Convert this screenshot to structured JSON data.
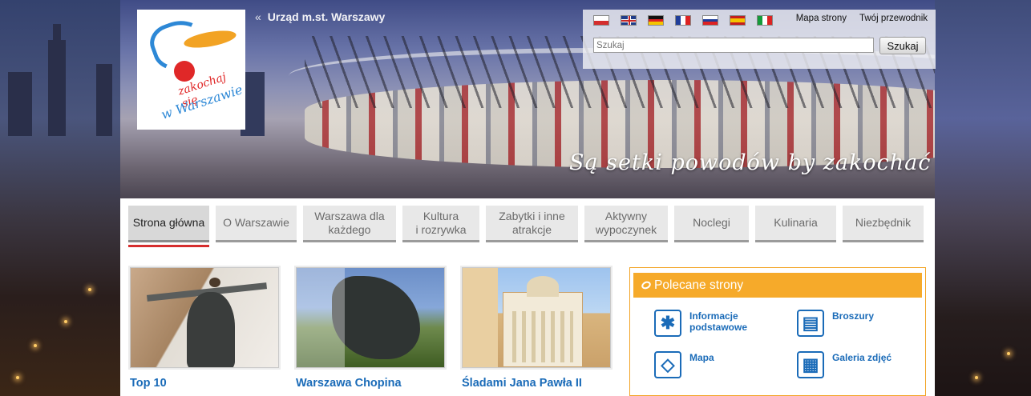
{
  "header": {
    "city_link": "Urząd m.st. Warszawy",
    "city_link_chevron": "«",
    "logo_line1": "zakochaj się",
    "logo_line2": "w Warszawie",
    "slogan": "Są setki powodów by zakochać się w Warszawie"
  },
  "utility": {
    "languages": [
      "polish-flag",
      "uk-flag",
      "german-flag",
      "french-flag",
      "russian-flag",
      "spanish-flag",
      "italian-flag"
    ],
    "links": [
      "Mapa strony",
      "Twój przewodnik"
    ],
    "search_placeholder": "Szukaj",
    "search_button": "Szukaj"
  },
  "nav": [
    {
      "label": "Strona główna",
      "active": true
    },
    {
      "label": "O Warszawie"
    },
    {
      "label": "Warszawa dla\nkażdego"
    },
    {
      "label": "Kultura\ni rozrywka"
    },
    {
      "label": "Zabytki i inne\natrakcje"
    },
    {
      "label": "Aktywny\nwypoczynek"
    },
    {
      "label": "Noclegi"
    },
    {
      "label": "Kulinaria"
    },
    {
      "label": "Niezbędnik"
    }
  ],
  "tiles": [
    {
      "caption": "Top 10"
    },
    {
      "caption": "Warszawa Chopina"
    },
    {
      "caption": "Śladami Jana Pawła II"
    }
  ],
  "recommended": {
    "title": "Polecane strony",
    "items": [
      {
        "label": "Informacje\npodstawowe",
        "icon": "asterisk-icon"
      },
      {
        "label": "Broszury",
        "icon": "brochure-icon"
      },
      {
        "label": "Mapa",
        "icon": "map-icon"
      },
      {
        "label": "Galeria zdjęć",
        "icon": "gallery-icon"
      }
    ]
  },
  "colors": {
    "link_blue": "#1a6bb8",
    "accent_orange": "#f6aa2a",
    "active_underline": "#d62e2e"
  }
}
